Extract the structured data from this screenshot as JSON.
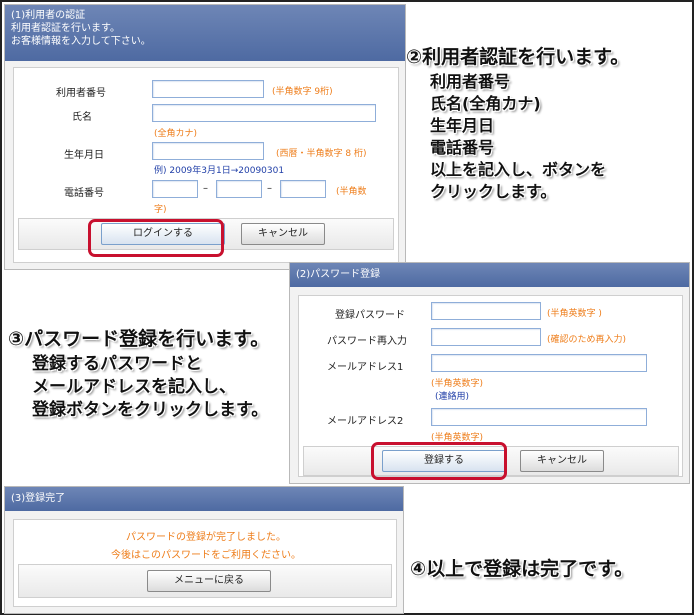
{
  "step1": {
    "header_title": "(1)利用者の認証",
    "header_line2": "利用者認証を行います。",
    "header_line3": "お客様情報を入力して下さい。",
    "fields": {
      "user_number_label": "利用者番号",
      "user_number_hint": "(半角数字 9桁)",
      "name_label": "氏名",
      "name_hint": "(全角カナ)",
      "birthdate_label": "生年月日",
      "birthdate_hint": "(西暦・半角数字 8 桁)",
      "birthdate_example": "例) 2009年3月1日→20090301",
      "phone_label": "電話番号",
      "phone_dash": "–",
      "phone_hint_1": "(半角数",
      "phone_hint_2": "字)"
    },
    "login_button": "ログインする",
    "cancel_button": "キャンセル"
  },
  "step2": {
    "header_title": "(2)パスワード登録",
    "password_label": "登録パスワード",
    "password_hint": "(半角英数字 )",
    "password_confirm_label": "パスワード再入力",
    "password_confirm_hint": "(確認のため再入力)",
    "mail1_label": "メールアドレス1",
    "mail1_hint": "(半角英数字)",
    "mail1_hint2": "(連絡用)",
    "mail2_label": "メールアドレス2",
    "mail2_hint": "(半角英数字)",
    "register_button": "登録する",
    "cancel_button": "キャンセル"
  },
  "step3": {
    "header_title": "(3)登録完了",
    "message_1": "パスワードの登録が完了しました。",
    "message_2": "今後はこのパスワードをご利用ください。",
    "menu_button": "メニューに戻る"
  },
  "annotations": {
    "note2": {
      "title": "②利用者認証を行います。",
      "lines": [
        "利用者番号",
        "氏名(全角カナ)",
        "生年月日",
        "電話番号",
        "以上を記入し、ボタンを",
        "クリックします。"
      ]
    },
    "note3": {
      "title": "③パスワード登録を行います。",
      "lines": [
        "登録するパスワードと",
        "メールアドレスを記入し、",
        "登録ボタンをクリックします。"
      ]
    },
    "note4": {
      "title": "④以上で登録は完了です。"
    }
  },
  "colors": {
    "header_blue": "#4e6aa2",
    "hint_orange": "#ee7d1a",
    "example_blue": "#2240a8",
    "highlight_red": "#c8102e"
  }
}
